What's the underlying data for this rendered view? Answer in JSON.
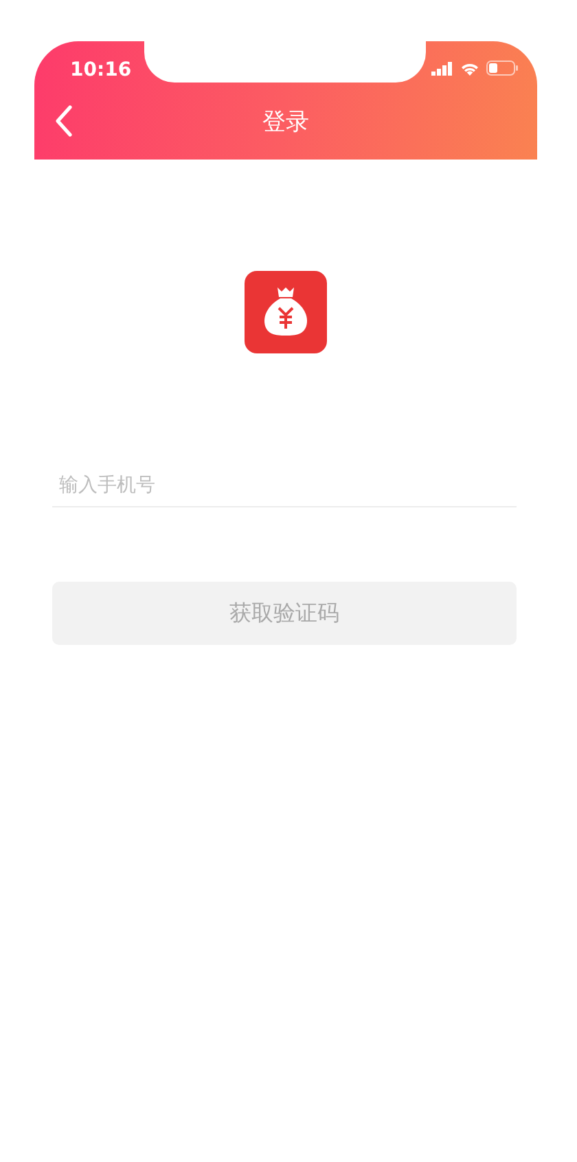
{
  "status_bar": {
    "time": "10:16"
  },
  "nav_bar": {
    "title": "登录"
  },
  "phone_field": {
    "placeholder": "输入手机号"
  },
  "code_button": {
    "label": "获取验证码",
    "disabled": true
  }
}
